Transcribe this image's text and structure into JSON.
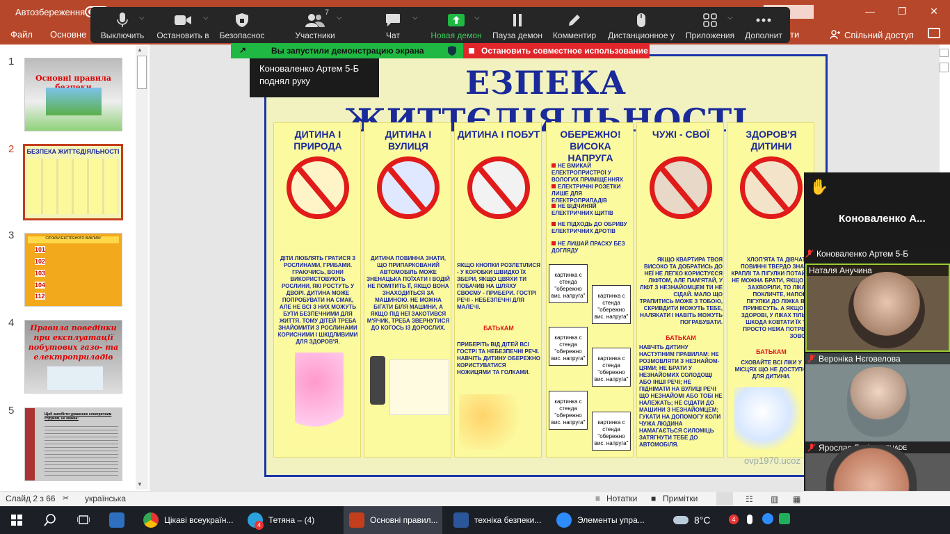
{
  "titlebar": {
    "autosave_label": "Автозбереження",
    "search_partial": "йти",
    "colors": {
      "brand": "#b7472a"
    }
  },
  "ribbon": {
    "tabs": [
      "Файл",
      "Основне"
    ],
    "tab_partial_right": "ти",
    "share_label": "Спільний доступ"
  },
  "zoom_toolbar": {
    "buttons": [
      {
        "label": "Выключить",
        "icon": "microphone-icon"
      },
      {
        "label": "Остановить в",
        "icon": "video-camera-icon"
      },
      {
        "label": "Безопаснос",
        "icon": "shield-icon"
      },
      {
        "label": "Участники",
        "icon": "participants-icon",
        "count": "7"
      },
      {
        "label": "Чат",
        "icon": "chat-bubble-icon"
      },
      {
        "label": "Новая демон",
        "icon": "share-screen-icon"
      },
      {
        "label": "Пауза демон",
        "icon": "pause-icon"
      },
      {
        "label": "Комментир",
        "icon": "pencil-icon"
      },
      {
        "label": "Дистанционное у",
        "icon": "mouse-icon"
      },
      {
        "label": "Приложения",
        "icon": "apps-icon"
      },
      {
        "label": "Дополнит",
        "icon": "more-icon"
      }
    ],
    "colors": {
      "active": "#3ccc5b"
    }
  },
  "share_bar": {
    "status": "Вы запустили демонстрацию экрана",
    "stop": "Остановить совместное использование"
  },
  "notification": {
    "line1": "Коноваленко Артем 5-Б",
    "line2": "поднял руку"
  },
  "thumbnails": [
    {
      "num": "1",
      "title": "Основні правила безпеки"
    },
    {
      "num": "2",
      "title": "БЕЗПЕКА ЖИТТЄДІЯЛЬНОСТІ"
    },
    {
      "num": "3",
      "title": "СЛУЖБИ ЕКСТРЕНОГО ВИКЛИКУ",
      "rows": [
        "101",
        "102",
        "103",
        "104",
        "112"
      ]
    },
    {
      "num": "4",
      "title": "Правила поведінки при експлуатації побутових газо- та електроприладів"
    },
    {
      "num": "5",
      "title": "Щоб запобігти ураженню електричним струмом, не можна:"
    }
  ],
  "slide": {
    "title": "БЕЗПЕКА ЖИТТЄДІЯЛЬНОСТІ",
    "title_visible": "ЕЗПЕКА ЖИТТЄДІЯЛЬНОСТІ",
    "columns": [
      {
        "head": "ДИТИНА І ПРИРОДА",
        "text": "ДІТИ ЛЮБЛЯТЬ ГРАТИСЯ З РОСЛИНАМИ, ГРИБАМИ. ГРАЮЧИСЬ, ВОНИ ВИКОРИСТОВУЮТЬ РОСЛИНИ, ЯКІ РОСТУТЬ У ДВОРІ. ДИТИНА МОЖЕ ПОПРОБУВАТИ НА СМАК, АЛЕ НЕ ВСІ З НИХ МОЖУТЬ БУТИ БЕЗПЕЧНИМИ ДЛЯ ЖИТТЯ. ТОМУ ДІТЕЙ ТРЕБА ЗНАЙОМИТИ З РОСЛИНАМИ КОРИСНИМИ І ШКІДЛИВИМИ ДЛЯ ЗДОРОВ'Я."
      },
      {
        "head": "ДИТИНА І ВУЛИЦЯ",
        "text": "ДИТИНА ПОВИННА ЗНАТИ, ЩО ПРИПАРКОВАНИЙ АВТОМОБІЛЬ МОЖЕ ЗНЕНАЦЬКА ПОЇХАТИ І ВОДІЙ НЕ ПОМІТИТЬ ЇЇ, ЯКЩО ВОНА ЗНАХОДИТЬСЯ ЗА МАШИНОЮ. НЕ МОЖНА БІГАТИ БІЛЯ МАШИНИ, А ЯКЩО ПІД НЕЇ ЗАКОТИВСЯ М'ЯЧИК, ТРЕБА ЗВЕРНУТИСЯ ДО КОГОСЬ ІЗ ДОРОСЛИХ."
      },
      {
        "head": "ДИТИНА І ПОБУТ",
        "text": "ЯКЩО КНОПКИ РОЗЛЕТІЛИСЯ - У КОРОБКИ ШВИДКО ЇХ ЗБЕРИ, ЯКЩО ЦВЯХИ ТИ ПОБАЧИВ НА ШЛЯХУ СВОЄМУ - ПРИБЕРИ. ГОСТРІ РЕЧІ - НЕБЕЗПЕЧНІ ДЛЯ МАЛЕЧІ.",
        "red": "БАТЬКАМ",
        "text2": "ПРИБЕРІТЬ ВІД ДІТЕЙ ВСІ ГОСТРІ ТА НЕБЕЗПЕЧНІ РЕЧІ. НАВЧІТЬ ДИТИНУ ОБЕРЕЖНО КОРИСТУВАТИСЯ НОЖИЦЯМИ ТА ГОЛКАМИ."
      },
      {
        "head": "ОБЕРЕЖНО! ВИСОКА НАПРУГА",
        "bullets": [
          "НЕ ВМИКАЙ ЕЛЕКТРОПРИСТРОЇ У ВОЛОГИХ ПРИМІЩЕННЯХ",
          "ЕЛЕКТРИЧНІ РОЗЕТКИ ЛИШЕ ДЛЯ ЕЛЕКТРОПРИЛАДІВ",
          "НЕ ВІДЧИНЯЙ ЕЛЕКТРИЧНИХ ЩИТІВ",
          "НЕ ПІДХОДЬ ДО ОБРИВУ ЕЛЕКТРИЧНИХ ДРОТІВ",
          "НЕ ЛИШАЙ ПРАСКУ БЕЗ ДОГЛЯДУ"
        ],
        "card": "картинка с стенда \"обережно вис. напруга\""
      },
      {
        "head": "ЧУЖІ - СВОЇ",
        "text": "ЯКЩО КВАРТИРА ТВОЯ ВИСОКО ТА ДОБРАТИСЬ ДО НЕЇ НЕ ЛЕГКО КОРИСТУЄСЯ ЛІФТОМ, АЛЕ ПАМ'ЯТАЙ, У ЛІФТ З НЕЗНАЙОМЦЕМ ТИ НЕ СІДАЙ. МАЛО ЩО ТРАПИТИСЬ МОЖЕ З ТОБОЮ, СКРИВДИТИ МОЖУТЬ ТЕБЕ, НАЛЯКАТИ І НАВІТЬ МОЖУТЬ ПОГРАБУВАТИ.",
        "red": "БАТЬКАМ",
        "text2": "НАВЧІТЬ ДИТИНУ НАСТУПНИМ ПРАВИЛАМ: НЕ РОЗМОВЛЯТИ З НЕЗНАЙОМ-ЦЯМИ; НЕ БРАТИ У НЕЗНАЙОМИХ СОЛОДОЩІ АБО ІНШІ РЕЧІ; НЕ ПІДНІМАТИ НА ВУЛИЦІ РЕЧІ ЩО НЕЗНАЙОМІ АБО ТОБІ НЕ НАЛЕЖАТЬ; НЕ СІДАТИ ДО МАШИНИ З НЕЗНАЙОМЦЕМ; ГУКАТИ НА ДОПОМОГУ КОЛИ ЧУЖА ЛЮДИНА НАМАГАЄТЬСЯ СИЛОМІЦЬ ЗАТЯГНУТИ ТЕБЕ ДО АВТОМОБІЛЯ."
      },
      {
        "head": "ЗДОРОВ'Я ДИТИНИ",
        "text": "ХЛОП'ЯТА ТА ДІВЧАТКА ПОВИННІ ТВЕРДО ЗНАТИ: КРАПЛІ ТА ПІГУЛКИ ПОТАЙКИ НЕ МОЖНА БРАТИ, ЯКЩО ВИ ЗАХВОРІЛИ, ТО ЛІКАРЯ ПОКЛИЧТЕ, НАПОЇ ТА ПІГУЛКИ ДО ЛІЖКА ВАМ ПРИНЕСУТЬ. А ЯКЩО ВИ ЗДОРОВІ, У ЛІКАХ ТІЛЬКИ ШКОДА КОВТАТИ ЇХ ТАК ПРОСТО НЕМА ПОТРЕБИ ЗОВСІМ.",
        "red": "БАТЬКАМ",
        "text2": "СХОВАЙТЕ ВСІ ЛІКИ У МІСЦЯХ ЩО НЕ ДОСТУПНІ ДЛЯ ДИТИНИ."
      }
    ],
    "watermark": "ovp1970.ucoz",
    "colors": {
      "border": "#1a35a8",
      "title": "#1a2a9a",
      "accent": "#e11a1a"
    }
  },
  "video_panel": {
    "active_speaker_name": "Коноваленко А...",
    "tiles": [
      {
        "name": "Коноваленко Артем 5-Б",
        "muted": true
      },
      {
        "name": "Наталя Анучина",
        "muted": false
      },
      {
        "name": "Вероніка Нєговелова",
        "muted": true
      },
      {
        "name": "Ярослав Горін",
        "muted": true,
        "overlay": "ADEUADE"
      }
    ]
  },
  "statusbar": {
    "slide_info": "Слайд 2 з 66",
    "language": "українська",
    "notes": "Нотатки",
    "comments": "Примітки"
  },
  "taskbar": {
    "items": [
      {
        "label": "Цікаві всеукраїн...",
        "icon": "chrome-icon"
      },
      {
        "label": "Тетяна – (4)",
        "icon": "telegram-icon",
        "badge": "4"
      },
      {
        "label": "Основні правил...",
        "icon": "powerpoint-icon"
      },
      {
        "label": "техніка безпеки...",
        "icon": "word-icon"
      },
      {
        "label": "Элементы упра...",
        "icon": "zoom-icon"
      }
    ],
    "weather": "8°C",
    "tray_badge": "4"
  }
}
